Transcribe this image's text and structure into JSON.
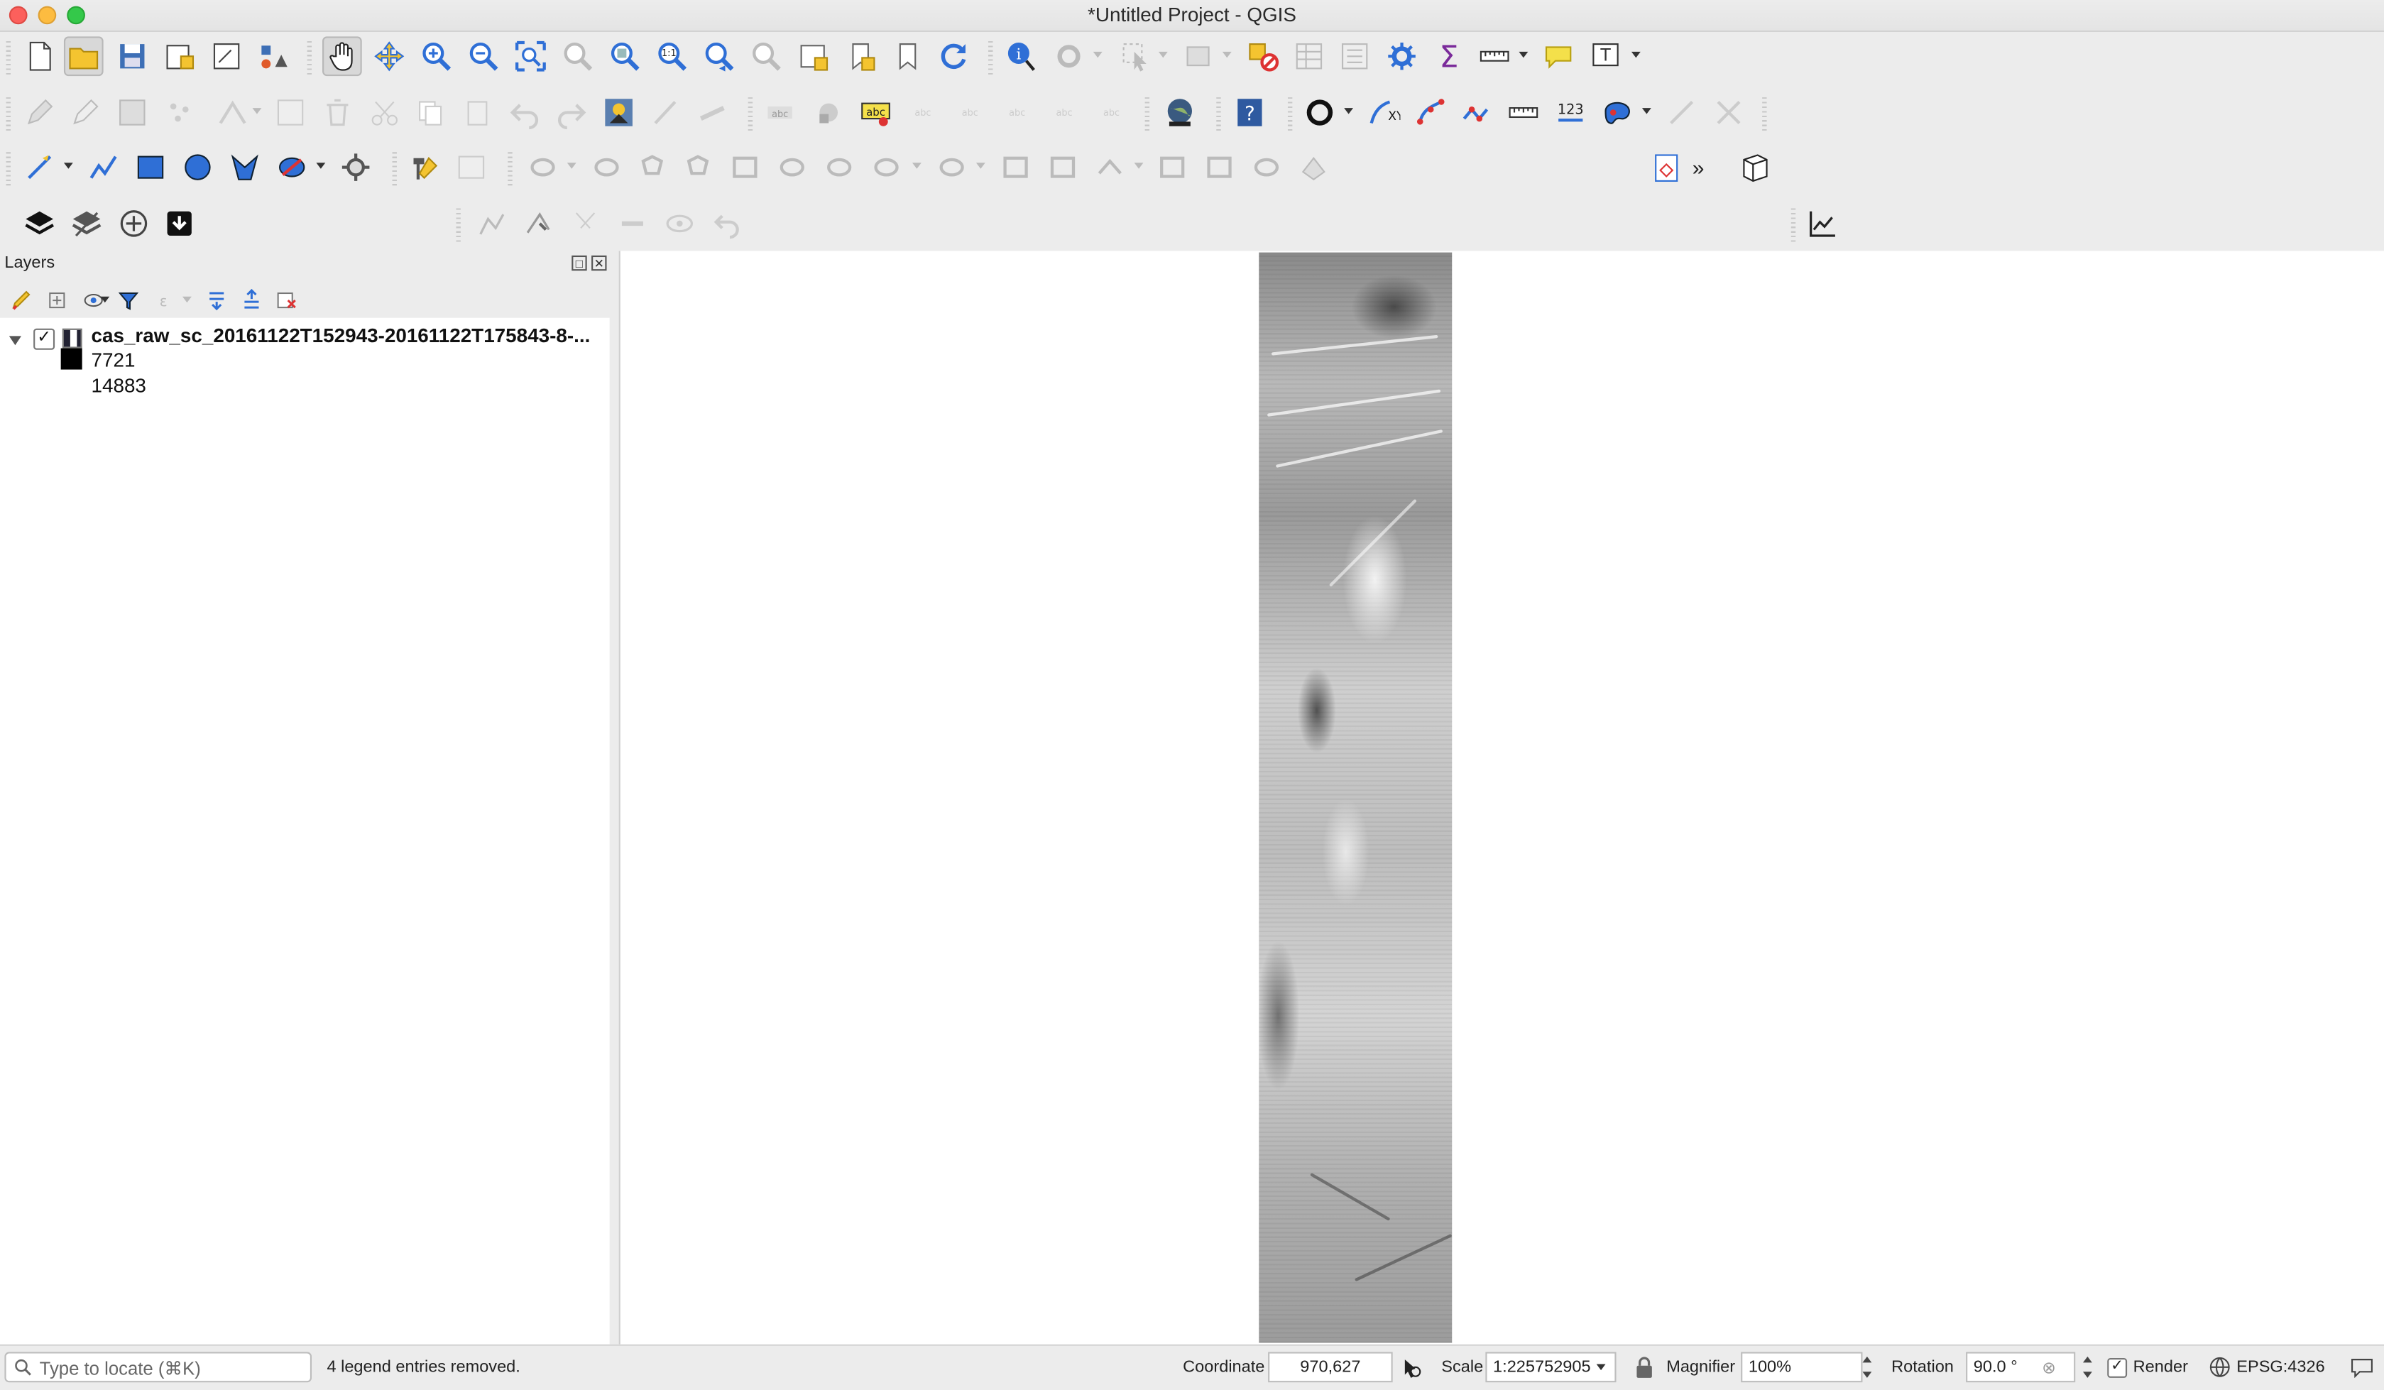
{
  "window": {
    "title": "*Untitled Project - QGIS"
  },
  "layers_panel": {
    "title": "Layers",
    "layer": {
      "name": "cas_raw_sc_20161122T152943-20161122T175843-8-...",
      "checked": true,
      "legend": [
        {
          "label": "7721",
          "color": "#000000"
        },
        {
          "label": "14883",
          "color": "#ffffff"
        }
      ]
    }
  },
  "statusbar": {
    "locator_placeholder": "Type to locate (⌘K)",
    "message": "4 legend entries removed.",
    "coordinate_label": "Coordinate",
    "coordinate_value": "970,627",
    "scale_label": "Scale",
    "scale_value": "1:225752905",
    "magnifier_label": "Magnifier",
    "magnifier_value": "100%",
    "rotation_label": "Rotation",
    "rotation_value": "90.0 °",
    "render_label": "Render",
    "render_checked": true,
    "crs": "EPSG:4326"
  },
  "colors": {
    "accent_blue": "#2f6fd6",
    "raster_gray": "#b9b9b9"
  }
}
